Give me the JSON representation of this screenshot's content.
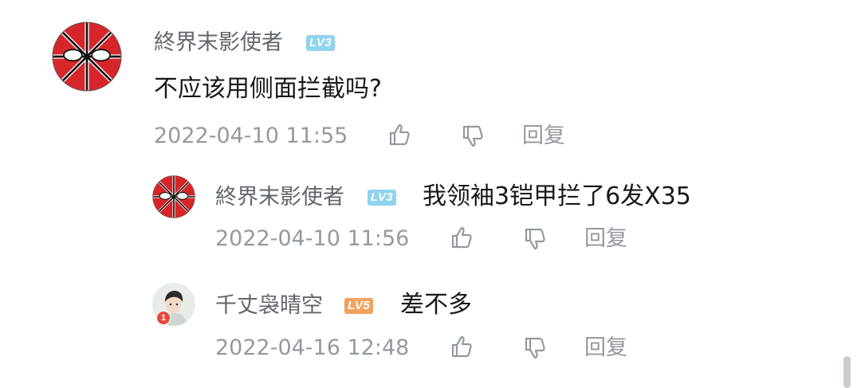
{
  "comment": {
    "username": "終界末影使者",
    "level": "LV3",
    "text": "不应该用侧面拦截吗?",
    "timestamp": "2022-04-10 11:55",
    "reply_label": "回复"
  },
  "replies": [
    {
      "username": "終界末影使者",
      "level": "LV3",
      "text": "我领袖3铠甲拦了6发X35",
      "timestamp": "2022-04-10 11:56",
      "reply_label": "回复"
    },
    {
      "username": "千丈袅晴空",
      "level": "LV5",
      "text": "差不多",
      "timestamp": "2022-04-16 12:48",
      "reply_label": "回复",
      "avatar_badge": "1"
    }
  ],
  "icons": [
    "like-icon",
    "dislike-icon"
  ],
  "colors": {
    "level3": "#8fd3ee",
    "level5": "#f2a25d",
    "username": "#61666d",
    "meta": "#9499a0"
  }
}
